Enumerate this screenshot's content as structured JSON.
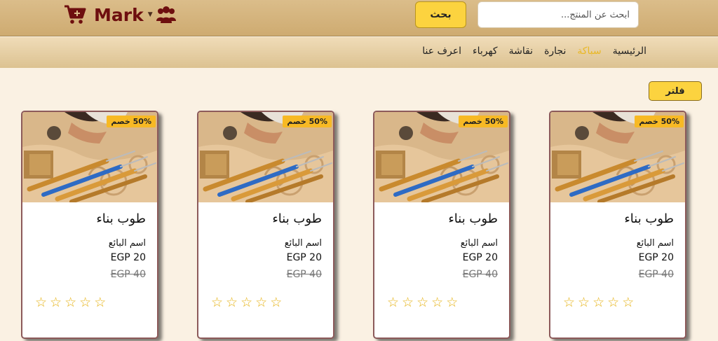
{
  "header": {
    "brand": "Mark",
    "search_placeholder": "ابحث عن المنتج...",
    "search_button": "بحث"
  },
  "nav": {
    "items": [
      {
        "label": "الرئيسية",
        "active": false
      },
      {
        "label": "سباكة",
        "active": true
      },
      {
        "label": "نجارة",
        "active": false
      },
      {
        "label": "نقاشة",
        "active": false
      },
      {
        "label": "كهرباء",
        "active": false
      },
      {
        "label": "اعرف عنا",
        "active": false
      }
    ]
  },
  "filter_button": "فلتر",
  "products": [
    {
      "badge": "50% خصم",
      "title": "طوب بناء",
      "seller": "اسم البائع",
      "price": "EGP 20",
      "old_price": "EGP 40",
      "rating": 0,
      "max_rating": 5
    },
    {
      "badge": "50% خصم",
      "title": "طوب بناء",
      "seller": "اسم البائع",
      "price": "EGP 20",
      "old_price": "EGP 40",
      "rating": 0,
      "max_rating": 5
    },
    {
      "badge": "50% خصم",
      "title": "طوب بناء",
      "seller": "اسم البائع",
      "price": "EGP 20",
      "old_price": "EGP 40",
      "rating": 0,
      "max_rating": 5
    },
    {
      "badge": "50% خصم",
      "title": "طوب بناء",
      "seller": "اسم البائع",
      "price": "EGP 20",
      "old_price": "EGP 40",
      "rating": 0,
      "max_rating": 5
    }
  ],
  "icons": {
    "cart": "shopping-cart-icon",
    "users": "users-icon",
    "dropdown": "caret-down-icon",
    "star": "star-outline-icon"
  },
  "colors": {
    "accent": "#fcd33f",
    "brand": "#6e0f0f",
    "active_nav": "#e9b826",
    "page_bg": "#faf1e3"
  }
}
